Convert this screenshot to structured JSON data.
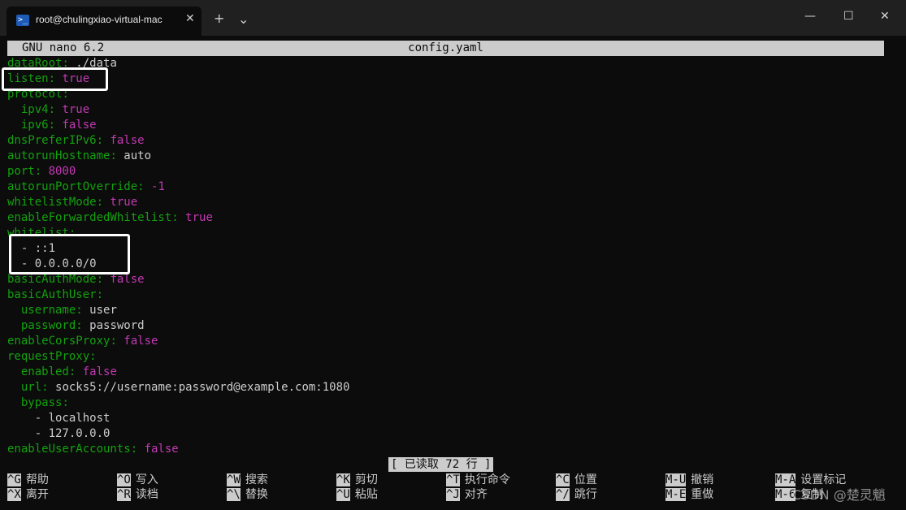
{
  "window": {
    "tab_title": "root@chulingxiao-virtual-mac",
    "tab_close": "✕",
    "new_tab": "+",
    "dropdown": "⌄",
    "minimize": "—",
    "maximize": "☐",
    "close": "✕"
  },
  "nano": {
    "version": "GNU nano 6.2",
    "filename": "config.yaml",
    "status": "[ 已读取 72 行 ]"
  },
  "lines": [
    {
      "indent": "",
      "key": "dataRoot",
      "value": "./data",
      "vtype": "plain"
    },
    {
      "indent": "",
      "key": "listen",
      "value": "true",
      "vtype": "purple"
    },
    {
      "indent": "",
      "key": "protocol",
      "value": "",
      "vtype": "plain"
    },
    {
      "indent": "  ",
      "key": "ipv4",
      "value": "true",
      "vtype": "purple"
    },
    {
      "indent": "  ",
      "key": "ipv6",
      "value": "false",
      "vtype": "purple"
    },
    {
      "indent": "",
      "key": "dnsPreferIPv6",
      "value": "false",
      "vtype": "purple"
    },
    {
      "indent": "",
      "key": "autorunHostname",
      "value": "auto",
      "vtype": "plain"
    },
    {
      "indent": "",
      "key": "port",
      "value": "8000",
      "vtype": "purple"
    },
    {
      "indent": "",
      "key": "autorunPortOverride",
      "value": "-1",
      "vtype": "purple"
    },
    {
      "indent": "",
      "key": "whitelistMode",
      "value": "true",
      "vtype": "purple"
    },
    {
      "indent": "",
      "key": "enableForwardedWhitelist",
      "value": "true",
      "vtype": "purple"
    },
    {
      "indent": "",
      "key": "whitelist",
      "value": "",
      "vtype": "plain"
    },
    {
      "indent": "  ",
      "key": "",
      "value": "- ::1",
      "vtype": "plain"
    },
    {
      "indent": "  ",
      "key": "",
      "value": "- 0.0.0.0/0",
      "vtype": "plain"
    },
    {
      "indent": "",
      "key": "basicAuthMode",
      "value": "false",
      "vtype": "purple"
    },
    {
      "indent": "",
      "key": "basicAuthUser",
      "value": "",
      "vtype": "plain"
    },
    {
      "indent": "  ",
      "key": "username",
      "value": "user",
      "vtype": "plain"
    },
    {
      "indent": "  ",
      "key": "password",
      "value": "password",
      "vtype": "plain"
    },
    {
      "indent": "",
      "key": "enableCorsProxy",
      "value": "false",
      "vtype": "purple"
    },
    {
      "indent": "",
      "key": "requestProxy",
      "value": "",
      "vtype": "plain"
    },
    {
      "indent": "  ",
      "key": "enabled",
      "value": "false",
      "vtype": "purple"
    },
    {
      "indent": "  ",
      "key": "url",
      "value": "socks5://username:password@example.com:1080",
      "vtype": "plain"
    },
    {
      "indent": "  ",
      "key": "bypass",
      "value": "",
      "vtype": "plain"
    },
    {
      "indent": "    ",
      "key": "",
      "value": "- localhost",
      "vtype": "plain"
    },
    {
      "indent": "    ",
      "key": "",
      "value": "- 127.0.0.0",
      "vtype": "plain"
    },
    {
      "indent": "",
      "key": "enableUserAccounts",
      "value": "false",
      "vtype": "purple"
    }
  ],
  "shortcuts": [
    [
      {
        "key": "^G",
        "label": "帮助"
      },
      {
        "key": "^X",
        "label": "离开"
      }
    ],
    [
      {
        "key": "^O",
        "label": "写入"
      },
      {
        "key": "^R",
        "label": "读档"
      }
    ],
    [
      {
        "key": "^W",
        "label": "搜索"
      },
      {
        "key": "^\\",
        "label": "替换"
      }
    ],
    [
      {
        "key": "^K",
        "label": "剪切"
      },
      {
        "key": "^U",
        "label": "粘贴"
      }
    ],
    [
      {
        "key": "^T",
        "label": "执行命令"
      },
      {
        "key": "^J",
        "label": "对齐"
      }
    ],
    [
      {
        "key": "^C",
        "label": "位置"
      },
      {
        "key": "^/",
        "label": "跳行"
      }
    ],
    [
      {
        "key": "M-U",
        "label": "撤销"
      },
      {
        "key": "M-E",
        "label": "重做"
      }
    ],
    [
      {
        "key": "M-A",
        "label": "设置标记"
      },
      {
        "key": "M-6",
        "label": "复制"
      }
    ]
  ],
  "watermark": "CSDN @楚灵魈"
}
